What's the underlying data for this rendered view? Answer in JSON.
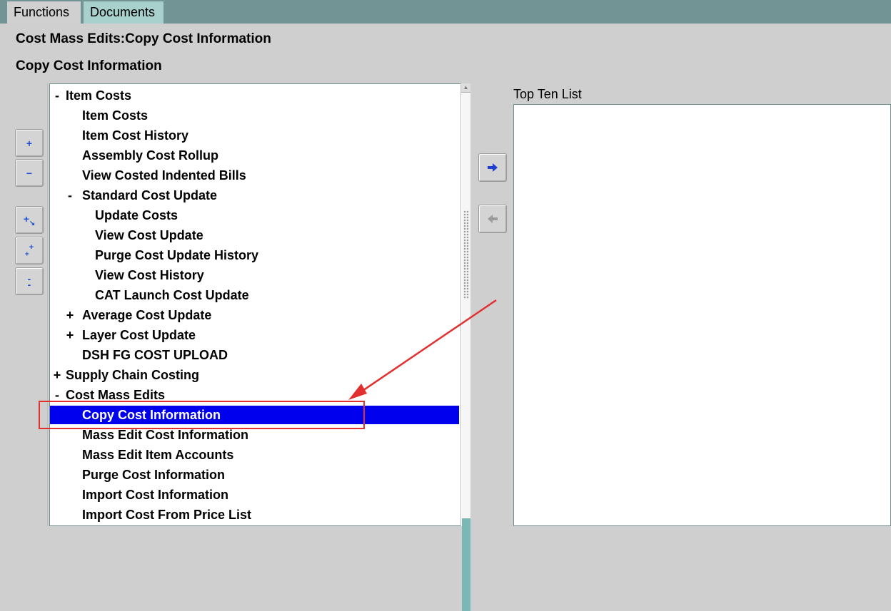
{
  "tabs": [
    {
      "label": "Functions"
    },
    {
      "label": "Documents"
    }
  ],
  "page_title": "Cost Mass Edits:Copy Cost Information",
  "section_title": "Copy Cost Information",
  "left_toolbar": {
    "buttons": [
      {
        "icon": "expand-plus-icon",
        "glyph": "+"
      },
      {
        "icon": "collapse-minus-icon",
        "glyph": "−"
      },
      {
        "icon": "expand-branch-icon",
        "glyph": "+↘"
      },
      {
        "icon": "expand-all-icon",
        "glyph": "++"
      },
      {
        "icon": "collapse-all-icon",
        "glyph": "="
      }
    ]
  },
  "tree": {
    "items": [
      {
        "toggle": "-",
        "label": "Item Costs",
        "level": 0
      },
      {
        "toggle": "",
        "label": "Item Costs",
        "level": 1
      },
      {
        "toggle": "",
        "label": "Item Cost History",
        "level": 1
      },
      {
        "toggle": "",
        "label": "Assembly Cost Rollup",
        "level": 1
      },
      {
        "toggle": "",
        "label": "View Costed Indented Bills",
        "level": 1
      },
      {
        "toggle": "-",
        "label": "Standard Cost Update",
        "level": 1
      },
      {
        "toggle": "",
        "label": "Update Costs",
        "level": 2
      },
      {
        "toggle": "",
        "label": "View Cost Update",
        "level": 2
      },
      {
        "toggle": "",
        "label": "Purge Cost Update History",
        "level": 2
      },
      {
        "toggle": "",
        "label": "View Cost History",
        "level": 2
      },
      {
        "toggle": "",
        "label": "CAT Launch Cost Update",
        "level": 2
      },
      {
        "toggle": "+",
        "label": "Average Cost Update",
        "level": 1
      },
      {
        "toggle": "+",
        "label": "Layer Cost Update",
        "level": 1
      },
      {
        "toggle": "",
        "label": "DSH FG COST UPLOAD",
        "level": 1
      },
      {
        "toggle": "+",
        "label": "Supply Chain Costing",
        "level": 0
      },
      {
        "toggle": "-",
        "label": "Cost Mass Edits",
        "level": 0
      },
      {
        "toggle": "",
        "label": "Copy Cost Information",
        "level": 1,
        "selected": true
      },
      {
        "toggle": "",
        "label": "Mass Edit Cost Information",
        "level": 1
      },
      {
        "toggle": "",
        "label": "Mass Edit Item Accounts",
        "level": 1
      },
      {
        "toggle": "",
        "label": "Purge Cost Information",
        "level": 1
      },
      {
        "toggle": "",
        "label": "Import Cost Information",
        "level": 1
      },
      {
        "toggle": "",
        "label": "Import Cost From Price List",
        "level": 1
      }
    ]
  },
  "move_buttons": {
    "add_icon": "right-arrow-icon",
    "remove_icon": "left-arrow-icon"
  },
  "top_ten": {
    "label": "Top Ten List"
  },
  "colors": {
    "tabbar": "#729494",
    "selection": "#0000ee",
    "annotation": "#e23030"
  }
}
